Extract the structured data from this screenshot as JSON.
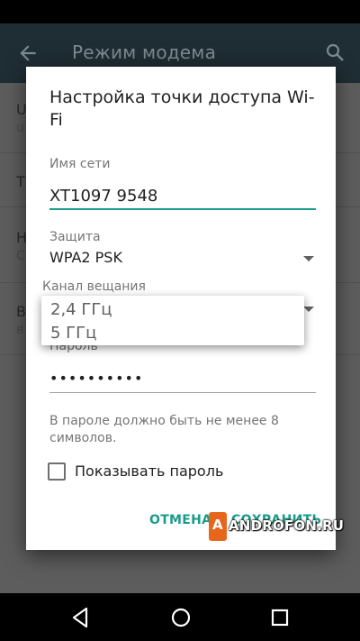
{
  "app_bar": {
    "title": "Режим модема",
    "back_icon": "arrow-left-icon",
    "search_icon": "search-icon"
  },
  "background_list": {
    "rows": [
      {
        "title": "U",
        "subtitle": "u"
      },
      {
        "title": "T",
        "subtitle": ""
      },
      {
        "title": "Н",
        "subtitle": "С"
      },
      {
        "title": "В",
        "subtitle": "в"
      }
    ]
  },
  "dialog": {
    "title": "Настройка точки доступа Wi-Fi",
    "network_name_label": "Имя сети",
    "network_name_value": "XT1097 9548",
    "security_label": "Защита",
    "security_value": "WPA2 PSK",
    "channel_label": "Канал вещания",
    "password_label": "Пароль",
    "password_value": "••••••••••",
    "password_hint": "В пароле должно быть не менее 8 символов.",
    "show_password_label": "Показывать пароль",
    "cancel_label": "ОТМЕНА",
    "save_label": "СОХРАНИТЬ"
  },
  "channel_popup": {
    "options": [
      "2,4 ГГц",
      "5 ГГц"
    ]
  },
  "watermark": {
    "logo_letter": "A",
    "text": "ANDROFON.RU",
    "color": "#e8661c"
  },
  "colors": {
    "accent": "#1b9b8b",
    "app_bar": "#1f2d34"
  },
  "nav_bar": {
    "back_icon": "nav-back-triangle-icon",
    "home_icon": "nav-home-circle-icon",
    "recents_icon": "nav-recents-square-icon"
  }
}
